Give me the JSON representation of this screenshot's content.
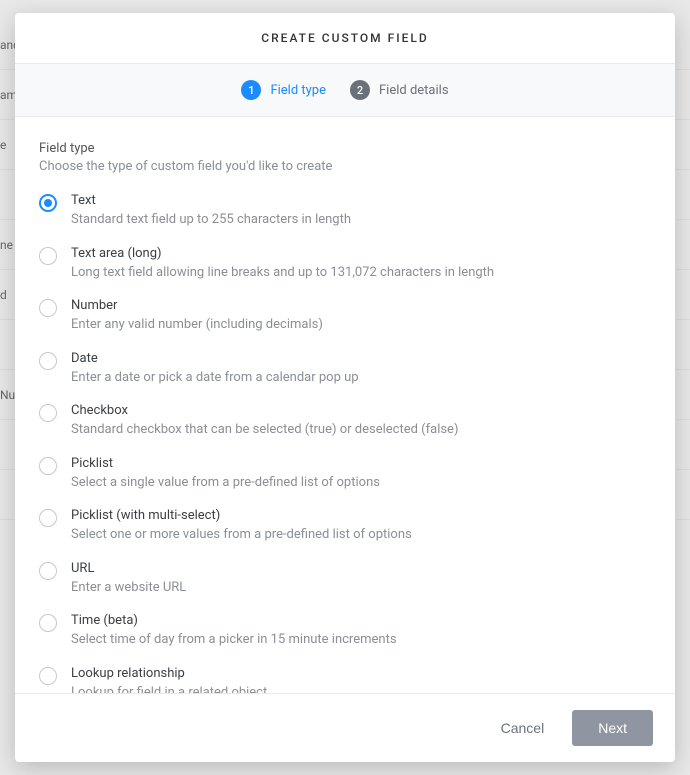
{
  "bg_rows": [
    "anc",
    "am",
    "e",
    "",
    "ne",
    "d",
    "",
    "Nu",
    "",
    ""
  ],
  "header": {
    "title": "CREATE CUSTOM FIELD"
  },
  "steps": [
    {
      "num": "1",
      "label": "Field type",
      "active": true
    },
    {
      "num": "2",
      "label": "Field details",
      "active": false
    }
  ],
  "section": {
    "title": "Field type",
    "description": "Choose the type of custom field you'd like to create"
  },
  "options": [
    {
      "id": "text",
      "title": "Text",
      "desc": "Standard text field up to 255 characters in length",
      "selected": true
    },
    {
      "id": "textarea",
      "title": "Text area (long)",
      "desc": "Long text field allowing line breaks and up to 131,072 characters in length",
      "selected": false
    },
    {
      "id": "number",
      "title": "Number",
      "desc": "Enter any valid number (including decimals)",
      "selected": false
    },
    {
      "id": "date",
      "title": "Date",
      "desc": "Enter a date or pick a date from a calendar pop up",
      "selected": false
    },
    {
      "id": "checkbox",
      "title": "Checkbox",
      "desc": "Standard checkbox that can be selected (true) or deselected (false)",
      "selected": false
    },
    {
      "id": "picklist",
      "title": "Picklist",
      "desc": "Select a single value from a pre-defined list of options",
      "selected": false
    },
    {
      "id": "picklist-multi",
      "title": "Picklist (with multi-select)",
      "desc": "Select one or more values from a pre-defined list of options",
      "selected": false
    },
    {
      "id": "url",
      "title": "URL",
      "desc": "Enter a website URL",
      "selected": false
    },
    {
      "id": "time",
      "title": "Time (beta)",
      "desc": "Select time of day from a picker in 15 minute increments",
      "selected": false
    },
    {
      "id": "lookup",
      "title": "Lookup relationship",
      "desc": "Lookup for field in a related object",
      "selected": false
    }
  ],
  "footer": {
    "cancel": "Cancel",
    "next": "Next"
  }
}
